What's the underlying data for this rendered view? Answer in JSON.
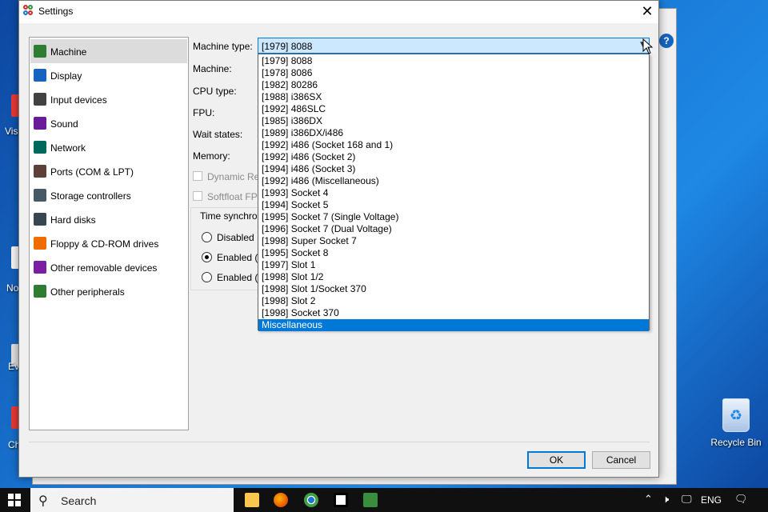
{
  "desktop": {
    "left_labels": [
      "Visi",
      "No",
      "Ev",
      "Ch"
    ],
    "recycle_bin_label": "Recycle Bin"
  },
  "background_window": {
    "help_label": "?"
  },
  "dialog": {
    "title": "Settings",
    "close_glyph": "✕",
    "sidebar": {
      "selected_index": 0,
      "items": [
        {
          "label": "Machine",
          "icon": "machine-icon"
        },
        {
          "label": "Display",
          "icon": "display-icon"
        },
        {
          "label": "Input devices",
          "icon": "input-devices-icon"
        },
        {
          "label": "Sound",
          "icon": "sound-icon"
        },
        {
          "label": "Network",
          "icon": "network-icon"
        },
        {
          "label": "Ports (COM & LPT)",
          "icon": "ports-icon"
        },
        {
          "label": "Storage controllers",
          "icon": "storage-controllers-icon"
        },
        {
          "label": "Hard disks",
          "icon": "hard-disks-icon"
        },
        {
          "label": "Floppy & CD-ROM drives",
          "icon": "floppy-cdrom-icon"
        },
        {
          "label": "Other removable devices",
          "icon": "removable-devices-icon"
        },
        {
          "label": "Other peripherals",
          "icon": "other-peripherals-icon"
        }
      ]
    },
    "fields": {
      "machine_type_label": "Machine type:",
      "machine_label": "Machine:",
      "cpu_type_label": "CPU type:",
      "fpu_label": "FPU:",
      "wait_states_label": "Wait states:",
      "memory_label": "Memory:",
      "dynamic_recompiler_label": "Dynamic Re",
      "softfloat_label": "Softfloat FPU",
      "time_sync_label": "Time synchro",
      "radio_disabled": "Disabled",
      "radio_enabled_1": "Enabled (l",
      "radio_enabled_2": "Enabled (U",
      "selected_radio": "enabled_1"
    },
    "combo": {
      "value": "[1979] 8088",
      "arrow": "▼"
    },
    "dropdown": {
      "highlighted": "Miscellaneous",
      "options": [
        "[1979] 8088",
        "[1978] 8086",
        "[1982] 80286",
        "[1988] i386SX",
        "[1992] 486SLC",
        "[1985] i386DX",
        "[1989] i386DX/i486",
        "[1992] i486 (Socket 168 and 1)",
        "[1992] i486 (Socket 2)",
        "[1994] i486 (Socket 3)",
        "[1992] i486 (Miscellaneous)",
        "[1993] Socket 4",
        "[1994] Socket 5",
        "[1995] Socket 7 (Single Voltage)",
        "[1996] Socket 7 (Dual Voltage)",
        "[1998] Super Socket 7",
        "[1995] Socket 8",
        "[1997] Slot 1",
        "[1998] Slot 1/2",
        "[1998] Slot 1/Socket 370",
        "[1998] Slot 2",
        "[1998] Socket 370",
        "Miscellaneous"
      ]
    },
    "buttons": {
      "ok": "OK",
      "cancel": "Cancel"
    }
  },
  "taskbar": {
    "search_placeholder": "Search",
    "search_glyph": "⚲",
    "apps": [
      "file-explorer-icon",
      "firefox-icon",
      "chrome-icon",
      "7zip-icon",
      "86box-icon"
    ],
    "tray": {
      "chevron": "⌃",
      "language": "ENG"
    }
  },
  "colors": {
    "accent": "#0078d7",
    "selection_bg": "#0078d7",
    "combo_bg": "#cce8ff",
    "sidebar_selected": "#dcdcdc"
  }
}
